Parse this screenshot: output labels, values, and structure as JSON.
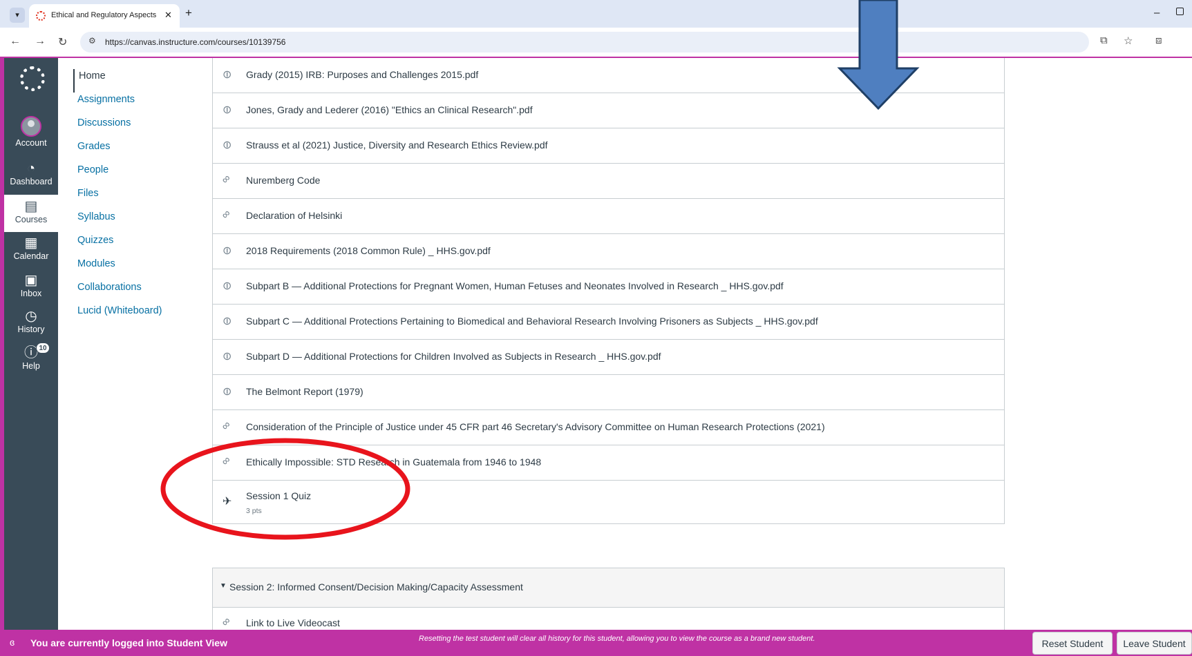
{
  "browser": {
    "tab_title": "Ethical and Regulatory Aspects",
    "url": "https://canvas.instructure.com/courses/10139756"
  },
  "global_nav": {
    "account": "Account",
    "dashboard": "Dashboard",
    "courses": "Courses",
    "calendar": "Calendar",
    "inbox": "Inbox",
    "history": "History",
    "help": "Help",
    "help_badge": "10"
  },
  "course_nav": {
    "items": [
      "Home",
      "Assignments",
      "Discussions",
      "Grades",
      "People",
      "Files",
      "Syllabus",
      "Quizzes",
      "Modules",
      "Collaborations",
      "Lucid (Whiteboard)"
    ]
  },
  "module1": {
    "items": [
      {
        "title": "Grady (2015) IRB: Purposes and Challenges 2015.pdf",
        "icon": "paperclip-icon"
      },
      {
        "title": "Jones, Grady and Lederer (2016) \"Ethics an Clinical Research\".pdf",
        "icon": "paperclip-icon"
      },
      {
        "title": "Strauss et al (2021) Justice, Diversity and Research Ethics Review.pdf",
        "icon": "paperclip-icon"
      },
      {
        "title": "Nuremberg Code",
        "icon": "link-icon"
      },
      {
        "title": "Declaration of Helsinki",
        "icon": "link-icon"
      },
      {
        "title": "2018 Requirements (2018 Common Rule) _ HHS.gov.pdf",
        "icon": "paperclip-icon"
      },
      {
        "title": "Subpart B — Additional Protections for Pregnant Women, Human Fetuses and Neonates Involved in Research _ HHS.gov.pdf",
        "icon": "paperclip-icon"
      },
      {
        "title": "Subpart C — Additional Protections Pertaining to Biomedical and Behavioral Research Involving Prisoners as Subjects _ HHS.gov.pdf",
        "icon": "paperclip-icon"
      },
      {
        "title": "Subpart D — Additional Protections for Children Involved as Subjects in Research _ HHS.gov.pdf",
        "icon": "paperclip-icon"
      },
      {
        "title": "The Belmont Report (1979)",
        "icon": "paperclip-icon"
      },
      {
        "title": "Consideration of the Principle of Justice under 45 CFR part 46 Secretary's Advisory Committee on Human Research Protections (2021)",
        "icon": "link-icon"
      },
      {
        "title": "Ethically Impossible: STD Research in Guatemala from 1946 to 1948",
        "icon": "link-icon"
      }
    ],
    "quiz": {
      "title": "Session 1 Quiz",
      "points": "3 pts"
    }
  },
  "module2": {
    "title": "Session 2: Informed Consent/Decision Making/Capacity Assessment",
    "first_item": "Link to Live Videocast"
  },
  "student_view": {
    "message": "You are currently logged into Student View",
    "description": "Resetting the test student will clear all history for this student, allowing you to view the course as a brand new student.",
    "reset_label": "Reset Student",
    "leave_label": "Leave Student"
  },
  "colors": {
    "nav_bg": "#394b58",
    "student_bar": "#bf32a4",
    "link": "#0770a3",
    "annotation_circle": "#e8141c",
    "annotation_arrow": "#4f7fc0"
  }
}
